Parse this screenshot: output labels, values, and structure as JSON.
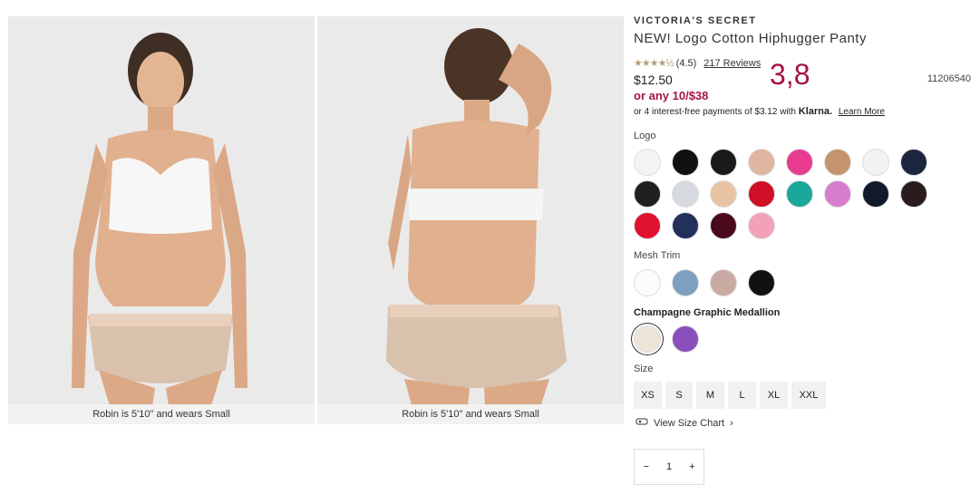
{
  "gallery": {
    "images": [
      {
        "caption": "Robin is 5'10\" and wears Small"
      },
      {
        "caption": "Robin is 5'10\" and wears Small"
      }
    ]
  },
  "product": {
    "brand": "VICTORIA'S SECRET",
    "title": "NEW! Logo Cotton Hiphugger Panty",
    "rating_text": "(4.5)",
    "reviews_text": "217 Reviews",
    "overlay_text": "3,8",
    "sku": "11206540",
    "price": "$12.50",
    "promo": "or any 10/$38",
    "klarna_prefix": "or 4 interest-free payments of $3.12 with",
    "klarna_brand": "Klarna.",
    "klarna_link": "Learn More"
  },
  "colors": {
    "logo_label": "Logo",
    "logo_swatches": [
      "#f4f4f4",
      "#111111",
      "#1a1a1a",
      "#dfb6a0",
      "#e83a8f",
      "#c4956c",
      "#f2f2f2",
      "#1c2640",
      "#1f1f1f",
      "#d6d9e0",
      "#e8c3a3",
      "#cf0f25",
      "#1aa89a",
      "#d67dd0",
      "#111a2a",
      "#2a1c1c",
      "#e0102f",
      "#23305a",
      "#4a0a1c",
      "#f3a1b6"
    ],
    "mesh_label": "Mesh Trim",
    "mesh_swatches": [
      "#fbfbfb",
      "#7f9fc0",
      "#c9aaa2",
      "#111111"
    ],
    "selected_label": "Champagne Graphic Medallion",
    "medallion_swatches": [
      "#ece4d6",
      "#8a4fbc"
    ]
  },
  "sizes": {
    "label": "Size",
    "options": [
      "XS",
      "S",
      "M",
      "L",
      "XL",
      "XXL"
    ]
  },
  "size_chart": {
    "label": "View Size Chart"
  },
  "quantity": {
    "value": "1",
    "minus": "−",
    "plus": "+"
  }
}
